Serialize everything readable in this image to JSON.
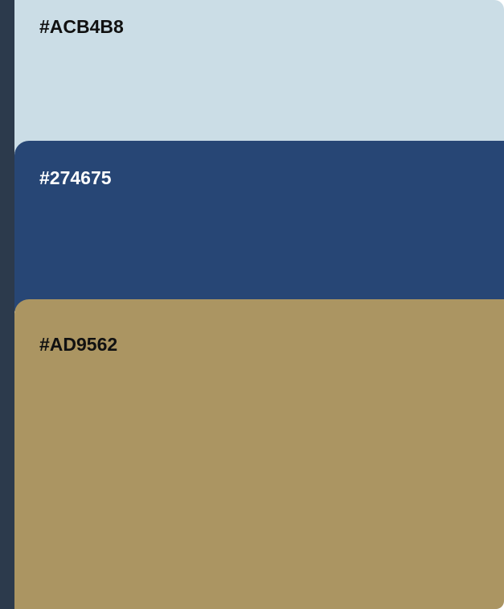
{
  "palette": {
    "swatches": [
      {
        "label": "#ACB4B8",
        "background": "#cbdde6",
        "text_color": "#111111"
      },
      {
        "label": "#274675",
        "background": "#274675",
        "text_color": "#ffffff"
      },
      {
        "label": "#AD9562",
        "background": "#ab9562",
        "text_color": "#111111"
      }
    ]
  },
  "colors": {
    "left_bar": "#2c3a4c"
  }
}
